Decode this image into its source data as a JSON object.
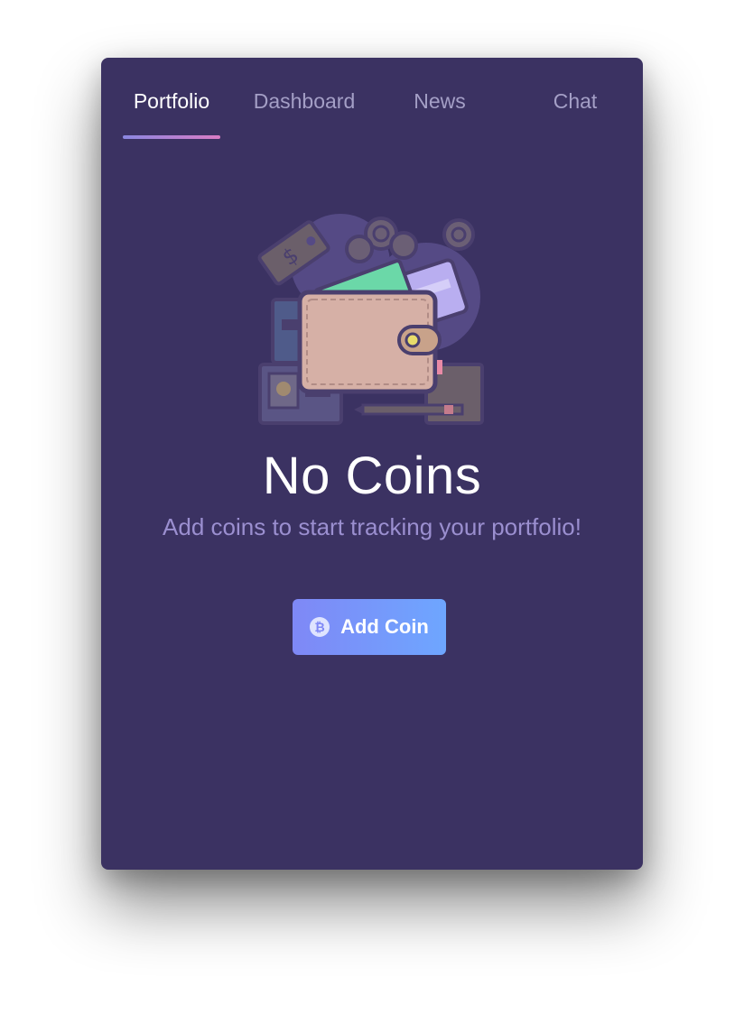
{
  "tabs": [
    {
      "label": "Portfolio",
      "active": true
    },
    {
      "label": "Dashboard",
      "active": false
    },
    {
      "label": "News",
      "active": false
    },
    {
      "label": "Chat",
      "active": false
    }
  ],
  "empty_state": {
    "illustration_icon": "wallet-illustration",
    "title": "No Coins",
    "subtitle": "Add coins to start tracking your portfolio!"
  },
  "add_button": {
    "label": "Add Coin",
    "icon": "bitcoin-icon",
    "icon_glyph": "₿"
  },
  "colors": {
    "background": "#3b3262",
    "accent_start": "#7f88f6",
    "accent_end": "#6ea6ff",
    "subtitle": "#9b8fd0",
    "tab_inactive": "#a49fc6"
  }
}
